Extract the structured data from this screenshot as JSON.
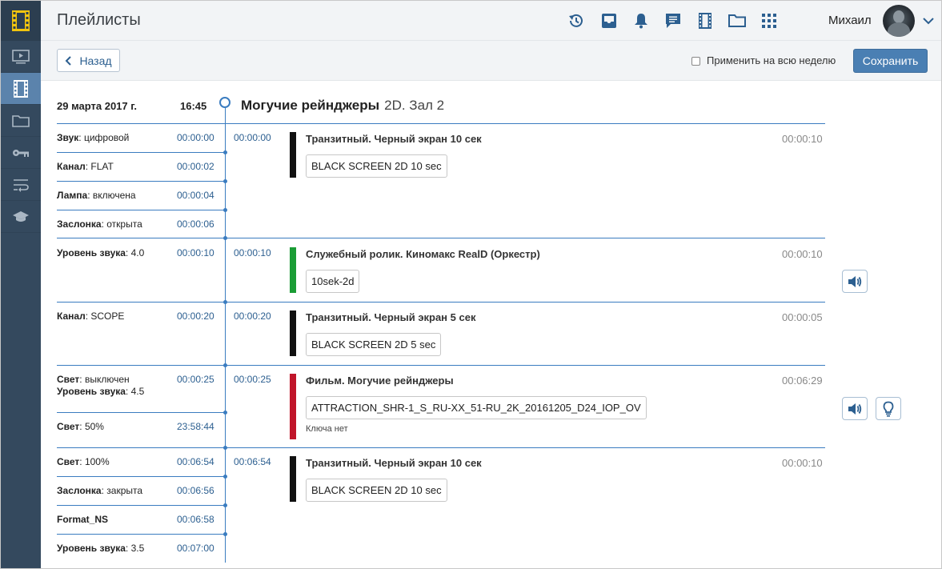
{
  "header": {
    "title": "Плейлисты",
    "user_name": "Михаил"
  },
  "toolbar": {
    "back_label": "Назад",
    "apply_week_label": "Применить на всю неделю",
    "save_label": "Сохранить"
  },
  "session": {
    "date": "29 марта 2017 г.",
    "time": "16:45",
    "movie_title": "Могучие рейнджеры",
    "movie_format_hall": "2D. Зал 2"
  },
  "events": [
    {
      "name": "Звук",
      "value": ": цифровой",
      "time": "00:00:00"
    },
    {
      "name": "Канал",
      "value": ": FLAT",
      "time": "00:00:02"
    },
    {
      "name": "Лампа",
      "value": ": включена",
      "time": "00:00:04"
    },
    {
      "name": "Заслонка",
      "value": ": открыта",
      "time": "00:00:06"
    },
    {
      "name": "Уровень звука",
      "value": ": 4.0",
      "time": "00:00:10"
    },
    {
      "name": "Канал",
      "value": ": SCOPE",
      "time": "00:00:20"
    },
    {
      "name": "Свет",
      "value": ": выключен",
      "time": "00:00:25"
    },
    {
      "name": "Уровень звука",
      "value": ": 4.5",
      "time": ""
    },
    {
      "name": "Свет",
      "value": ": 50%",
      "time": "23:58:44"
    },
    {
      "name": "Свет",
      "value": ": 100%",
      "time": "00:06:54"
    },
    {
      "name": "Заслонка",
      "value": ": закрыта",
      "time": "00:06:56"
    },
    {
      "name": "Format_NS",
      "value": "",
      "time": "00:06:58"
    },
    {
      "name": "Уровень звука",
      "value": ": 3.5",
      "time": "00:07:00"
    }
  ],
  "blocks": [
    {
      "start": "00:00:00",
      "title": "Транзитный. Черный экран 10 сек",
      "duration": "00:00:10",
      "file": "BLACK SCREEN 2D 10 sec",
      "color": "#111111"
    },
    {
      "start": "00:00:10",
      "title": "Служебный ролик. Киномакс RealD (Оркестр)",
      "duration": "00:00:10",
      "file": "10sek-2d",
      "color": "#1a9c35"
    },
    {
      "start": "00:00:20",
      "title": "Транзитный. Черный экран 5 сек",
      "duration": "00:00:05",
      "file": "BLACK SCREEN 2D 5 sec",
      "color": "#111111"
    },
    {
      "start": "00:00:25",
      "title": "Фильм. Могучие рейнджеры",
      "duration": "00:06:29",
      "file": "ATTRACTION_SHR-1_S_RU-XX_51-RU_2K_20161205_D24_IOP_OV",
      "note": "Ключа нет",
      "color": "#c0152a"
    },
    {
      "start": "00:06:54",
      "title": "Транзитный. Черный экран 10 сек",
      "duration": "00:00:10",
      "file": "BLACK SCREEN 2D 10 sec",
      "color": "#111111"
    }
  ],
  "icons": {
    "accent": "#2c5f90",
    "top": [
      "history-icon",
      "inbox-icon",
      "bell-icon",
      "chat-icon",
      "film-icon",
      "folder-icon",
      "grid-icon"
    ],
    "sidebar": [
      "play-icon",
      "film-icon",
      "folder-icon",
      "key-icon",
      "wrap-icon",
      "graduation-cap-icon"
    ]
  }
}
